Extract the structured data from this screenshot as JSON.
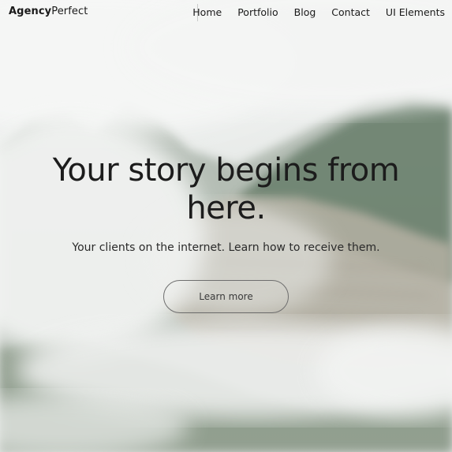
{
  "nav": {
    "brand_bold": "Agency",
    "brand_light": "Perfect",
    "links": [
      "Home",
      "Portfolio",
      "Blog",
      "Contact",
      "UI Elements"
    ]
  },
  "hero": {
    "title_line1": "Your story begins from",
    "title_line2": "here.",
    "subtitle": "Your clients on the internet. Learn how to receive them.",
    "cta_label": "Learn more"
  },
  "colors": {
    "text": "#1c1c1c",
    "button_border": "#6e6e6e"
  }
}
